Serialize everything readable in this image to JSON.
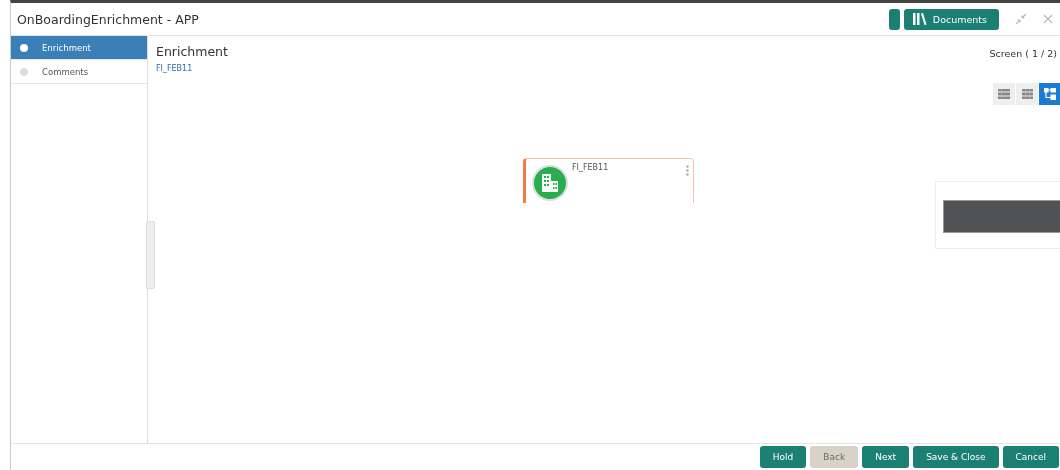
{
  "window": {
    "title": "OnBoardingEnrichment - APP",
    "documents_button": "Documents"
  },
  "steps": [
    {
      "label": "Enrichment",
      "selected": true
    },
    {
      "label": "Comments",
      "selected": false
    }
  ],
  "content": {
    "title": "Enrichment",
    "subtitle": "FI_FEB11",
    "screen_counter": "Screen ( 1 / 2)"
  },
  "views": [
    {
      "kind": "list",
      "selected": false
    },
    {
      "kind": "grid",
      "selected": false
    },
    {
      "kind": "tree",
      "selected": true
    }
  ],
  "node": {
    "label": "FI_FEB11"
  },
  "buttons": [
    {
      "label": "Hold",
      "disabled": false
    },
    {
      "label": "Back",
      "disabled": true
    },
    {
      "label": "Next",
      "disabled": false
    },
    {
      "label": "Save & Close",
      "disabled": false
    },
    {
      "label": "Cancel",
      "disabled": false
    }
  ]
}
